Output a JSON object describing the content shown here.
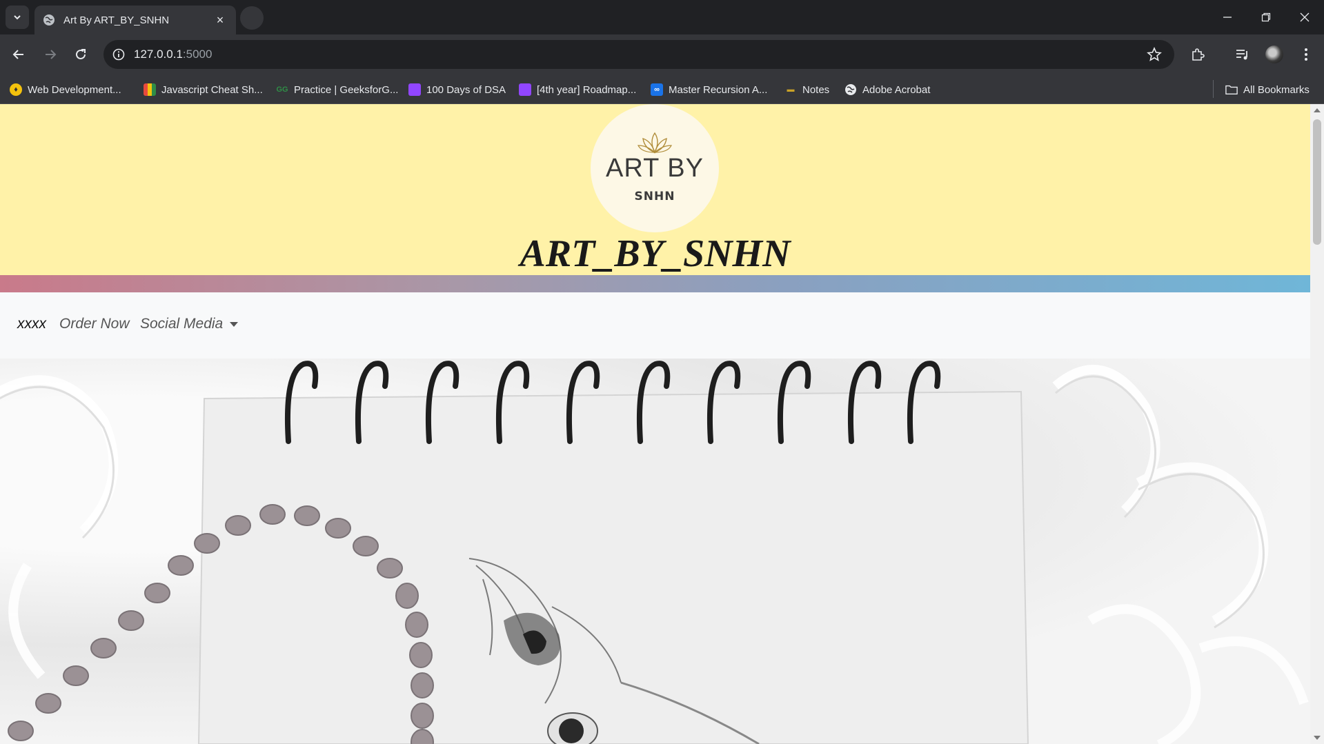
{
  "browser": {
    "tab_title": "Art By ART_BY_SNHN",
    "tab_close": "×",
    "url_host": "127.0.0.1",
    "url_port": ":5000"
  },
  "bookmarks": [
    {
      "label": "Web Development...",
      "icon": "web-dev-icon",
      "color": "#f4c20d"
    },
    {
      "label": "Javascript Cheat Sh...",
      "icon": "bars-icon",
      "color": "#e8a33d"
    },
    {
      "label": "Practice | GeeksforG...",
      "icon": "geeksforgeeks-icon",
      "color": "#2f8d46"
    },
    {
      "label": "100 Days of DSA",
      "icon": "twitch-icon",
      "color": "#9146ff"
    },
    {
      "label": "[4th year] Roadmap...",
      "icon": "twitch-icon",
      "color": "#9146ff"
    },
    {
      "label": "Master Recursion A...",
      "icon": "infinity-icon",
      "color": "#1a73e8"
    },
    {
      "label": "Notes",
      "icon": "notes-icon",
      "color": "#c9a227"
    },
    {
      "label": "Adobe Acrobat",
      "icon": "globe-icon",
      "color": "#e8eaed"
    }
  ],
  "all_bookmarks": "All Bookmarks",
  "site": {
    "logo_line1": "ART BY",
    "logo_line2": "SNHN",
    "title": "ART_BY_SNHN"
  },
  "nav": {
    "brand": "xxxx",
    "order": "Order Now",
    "social": "Social Media"
  },
  "colors": {
    "hero_bg": "#fff2a8",
    "gradient_start": "#c97a8a",
    "gradient_end": "#6fb6d8",
    "navbar_bg": "#f8f9fa"
  }
}
